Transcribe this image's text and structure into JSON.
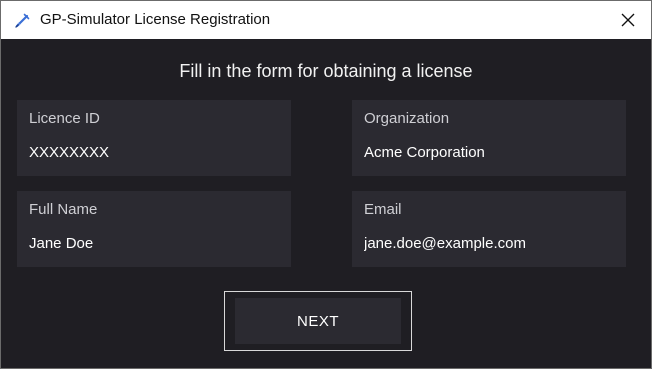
{
  "window": {
    "title": "GP-Simulator License Registration",
    "app_icon": "syringe-icon",
    "close_icon": "close-icon"
  },
  "form": {
    "heading": "Fill in the form for obtaining a license",
    "fields": [
      {
        "label": "Licence ID",
        "value": "XXXXXXXX"
      },
      {
        "label": "Organization",
        "value": "Acme Corporation"
      },
      {
        "label": "Full Name",
        "value": "Jane Doe"
      },
      {
        "label": "Email",
        "value": "jane.doe@example.com"
      }
    ],
    "next_label": "NEXT"
  },
  "colors": {
    "background": "#1f1e23",
    "field_background": "#2b2a31",
    "text": "#ffffff",
    "label_text": "#cfcfd4",
    "icon_accent": "#3b6fd6"
  }
}
